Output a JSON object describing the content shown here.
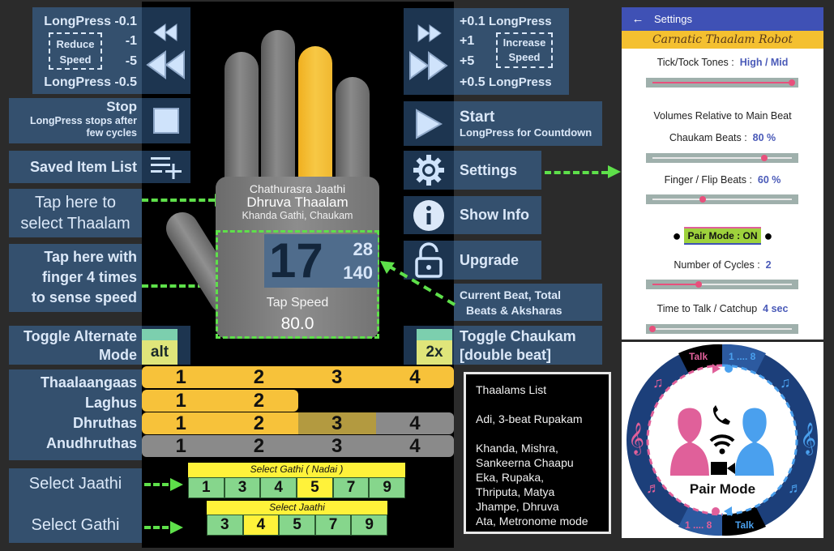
{
  "left_panel": {
    "reduce_speed": {
      "line1": "LongPress -0.1",
      "box_label_1": "Reduce",
      "box_label_2": "Speed",
      "step1": "-1",
      "step5": "-5",
      "line4": "LongPress -0.5"
    },
    "stop": {
      "title": "Stop",
      "desc_1": "LongPress stops after",
      "desc_2": "few cycles"
    },
    "saved_item_list": "Saved Item List",
    "tap_select_1": "Tap here to",
    "tap_select_2": "select Thaalam",
    "tap_speed_1": "Tap here with",
    "tap_speed_2": "finger 4 times",
    "tap_speed_3": "to sense speed",
    "toggle_alt_1": "Toggle Alternate",
    "toggle_alt_2": "Mode",
    "beat_rows_labels": [
      "Thaalaangaas",
      "Laghus",
      "Dhruthas",
      "Anudhruthas"
    ],
    "select_jaathi": "Select Jaathi",
    "select_gathi": "Select Gathi"
  },
  "right_panel": {
    "increase_speed": {
      "line1_val": "+0.1",
      "line1_lbl": "LongPress",
      "step1": "+1",
      "box_label_1": "Increase",
      "box_label_2": "Speed",
      "step5": "+5",
      "line4_val": "+0.5",
      "line4_lbl": "LongPress"
    },
    "start": {
      "title": "Start",
      "desc": "LongPress for Countdown"
    },
    "settings": "Settings",
    "show_info": "Show Info",
    "upgrade": "Upgrade",
    "current_beat_1": "Current Beat, Total",
    "current_beat_2": "Beats & Aksharas",
    "toggle_chaukam_1": "Toggle Chaukam",
    "toggle_chaukam_2": "[double beat]"
  },
  "phone": {
    "jaathi_line": "Chathurasra Jaathi",
    "thaalam_name": "Dhruva Thaalam",
    "gathi_line": "Khanda Gathi, Chaukam",
    "current_beat": "17",
    "total_beats": "28",
    "aksharas": "140",
    "tap_speed_label": "Tap Speed",
    "tap_speed_value": "80.0",
    "active_finger": 3,
    "alt_label": "alt",
    "chaukam_label": "2x",
    "beat_rows": [
      {
        "cells": [
          "1",
          "2",
          "3",
          "4"
        ],
        "state": [
          "on",
          "on",
          "on",
          "on"
        ]
      },
      {
        "cells": [
          "1",
          "2"
        ],
        "state": [
          "on",
          "on"
        ]
      },
      {
        "cells": [
          "1",
          "2",
          "3",
          "4"
        ],
        "state": [
          "on",
          "on",
          "dim",
          "off"
        ]
      },
      {
        "cells": [
          "1",
          "2",
          "3",
          "4"
        ],
        "state": [
          "off",
          "off",
          "off",
          "off"
        ]
      }
    ],
    "gathi_selector": {
      "title": "Select Gathi ( Nadai )",
      "options": [
        "1",
        "3",
        "4",
        "5",
        "7",
        "9"
      ],
      "selected": "5"
    },
    "jaathi_selector": {
      "title": "Select Jaathi",
      "options": [
        "3",
        "4",
        "5",
        "7",
        "9"
      ],
      "selected": "4"
    }
  },
  "thaalams_list": {
    "title": "Thaalams List",
    "group1": "Adi, 3-beat Rupakam",
    "group2": [
      "Khanda, Mishra,",
      "Sankeerna Chaapu",
      "Eka, Rupaka,",
      "Thriputa, Matya",
      "Jhampe, Dhruva",
      "Ata, Metronome mode"
    ]
  },
  "settings_screen": {
    "header_title": "Settings",
    "banner": "Carnatic Thaalam Robot",
    "tick_tock_label": "Tick/Tock Tones :",
    "tick_tock_value": "High / Mid",
    "tick_tock_level": 1.0,
    "volumes_heading": "Volumes Relative to Main Beat",
    "chaukam_label": "Chaukam Beats :",
    "chaukam_value": "80 %",
    "chaukam_level": 0.8,
    "finger_label": "Finger / Flip Beats :",
    "finger_value": "60 %",
    "finger_level": 0.36,
    "pair_mode": "Pair Mode : ON",
    "cycles_label": "Number of Cycles :",
    "cycles_value": "2",
    "cycles_level": 0.33,
    "talk_label": "Time to Talk / Catchup",
    "talk_value": "4 sec",
    "talk_level": 0.0
  },
  "pair_mode_graphic": {
    "title": "Pair Mode",
    "talk_top": "Talk",
    "count_top": "1 .... 8",
    "count_bottom": "1 .... 8",
    "talk_bottom": "Talk"
  },
  "colors": {
    "label_bg": "#34506e",
    "icon_bg": "#1d3550",
    "accent_green": "#5ee04a",
    "beat_on": "#f7c23a",
    "settings_header": "#3f51b5",
    "banner": "#f4c030",
    "pink": "#e0609a",
    "blue": "#4aa0ee"
  }
}
